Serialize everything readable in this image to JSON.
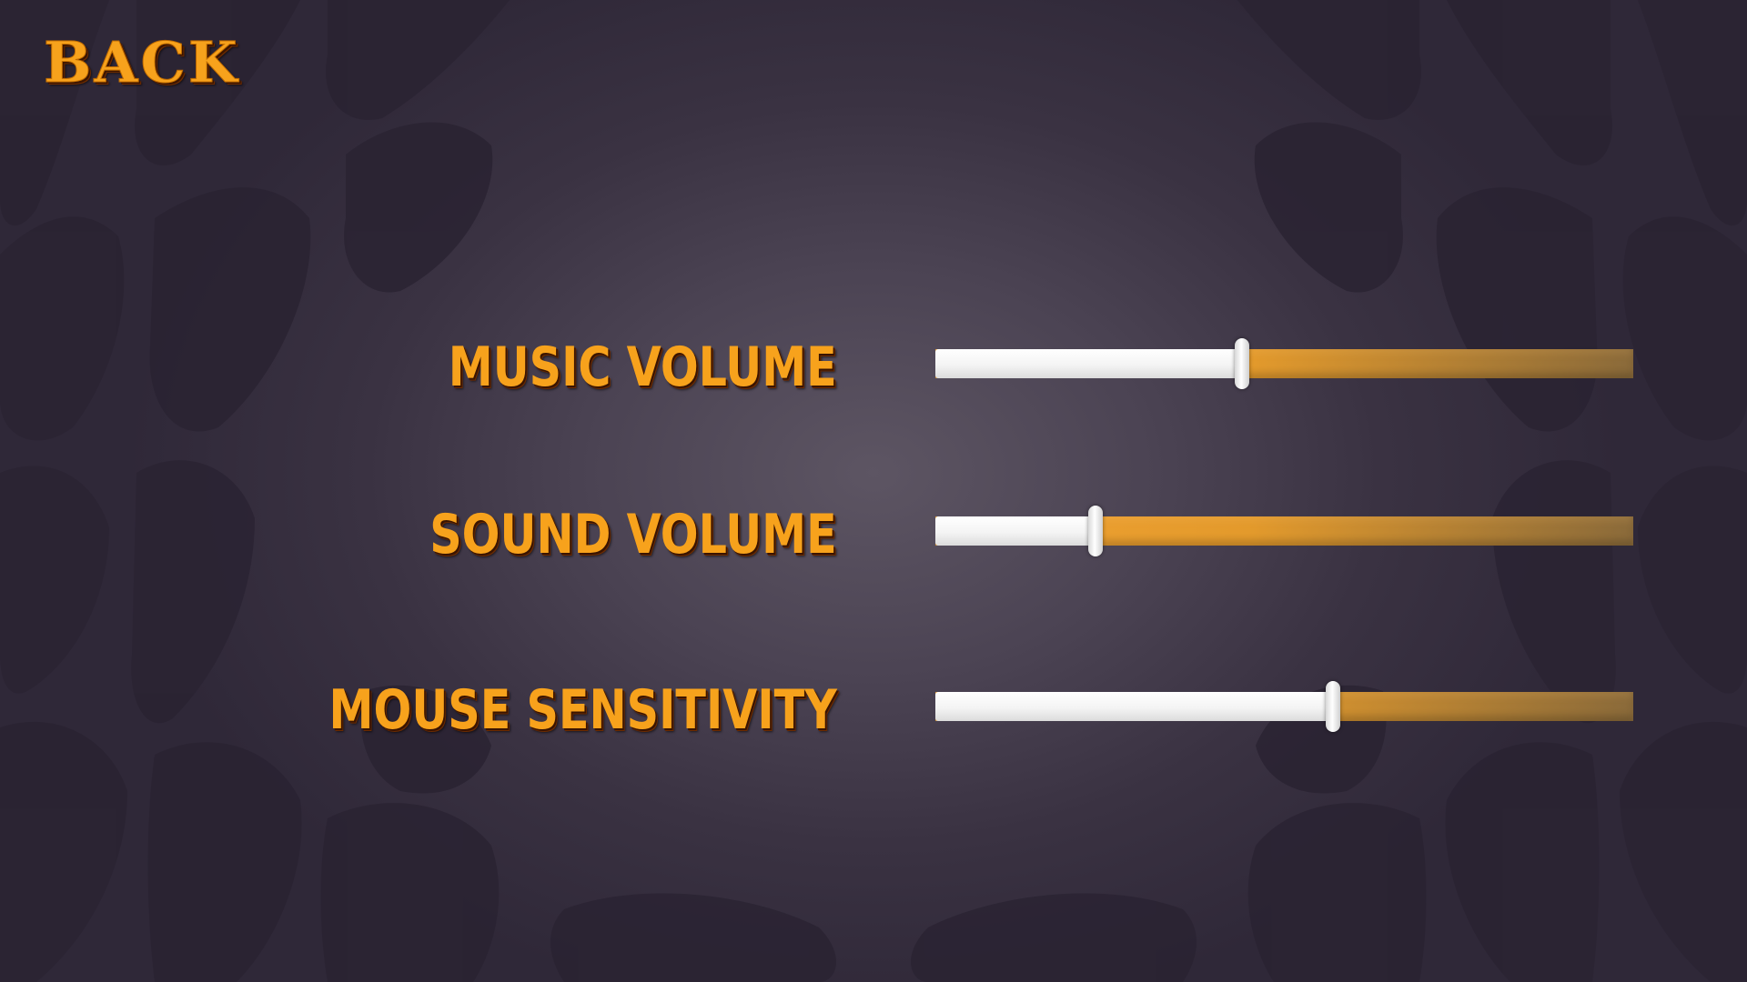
{
  "menu": {
    "back_label": "BACK"
  },
  "settings": [
    {
      "label": "MUSIC VOLUME",
      "value_fraction": 0.44
    },
    {
      "label": "SOUND VOLUME",
      "value_fraction": 0.23
    },
    {
      "label": "MOUSE SENSITIVITY",
      "value_fraction": 0.57
    }
  ],
  "colors": {
    "label": "#f7a21c",
    "slider_fill": "#f4f4f4",
    "slider_track": "#e39a2c",
    "background": "#3a3242",
    "veins": "#2a2332"
  }
}
